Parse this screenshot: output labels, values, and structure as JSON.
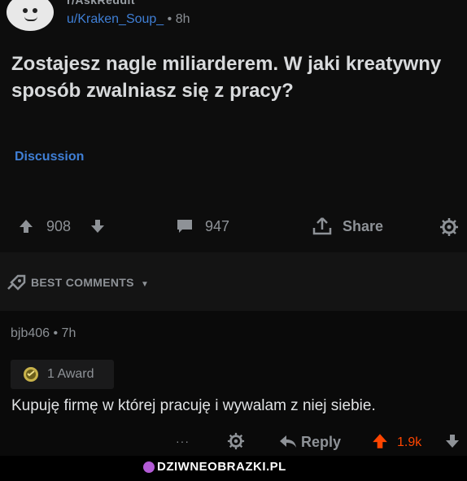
{
  "post": {
    "subreddit": "r/AskReddit",
    "author": "u/Kraken_Soup_",
    "time": "8h",
    "title": "Zostajesz nagle miliarderem. W jaki kreatywny sposób zwalniasz się z pracy?",
    "flair": "Discussion",
    "votes": "908",
    "comments": "947",
    "share_label": "Share"
  },
  "sort": {
    "label": "BEST COMMENTS"
  },
  "comment": {
    "author": "bjb406",
    "time": "7h",
    "award_label": "1 Award",
    "body": "Kupuję firmę w której pracuję i wywalam z niej siebie.",
    "more_label": "···",
    "reply_label": "Reply",
    "votes": "1.9k"
  },
  "watermark": {
    "text": "DZIWNEOBRAZKI.PL"
  },
  "colors": {
    "link_blue": "#3f7fd6",
    "upvote_red": "#ff4500",
    "text_light": "#d7dadc",
    "text_muted": "#8e9297"
  }
}
